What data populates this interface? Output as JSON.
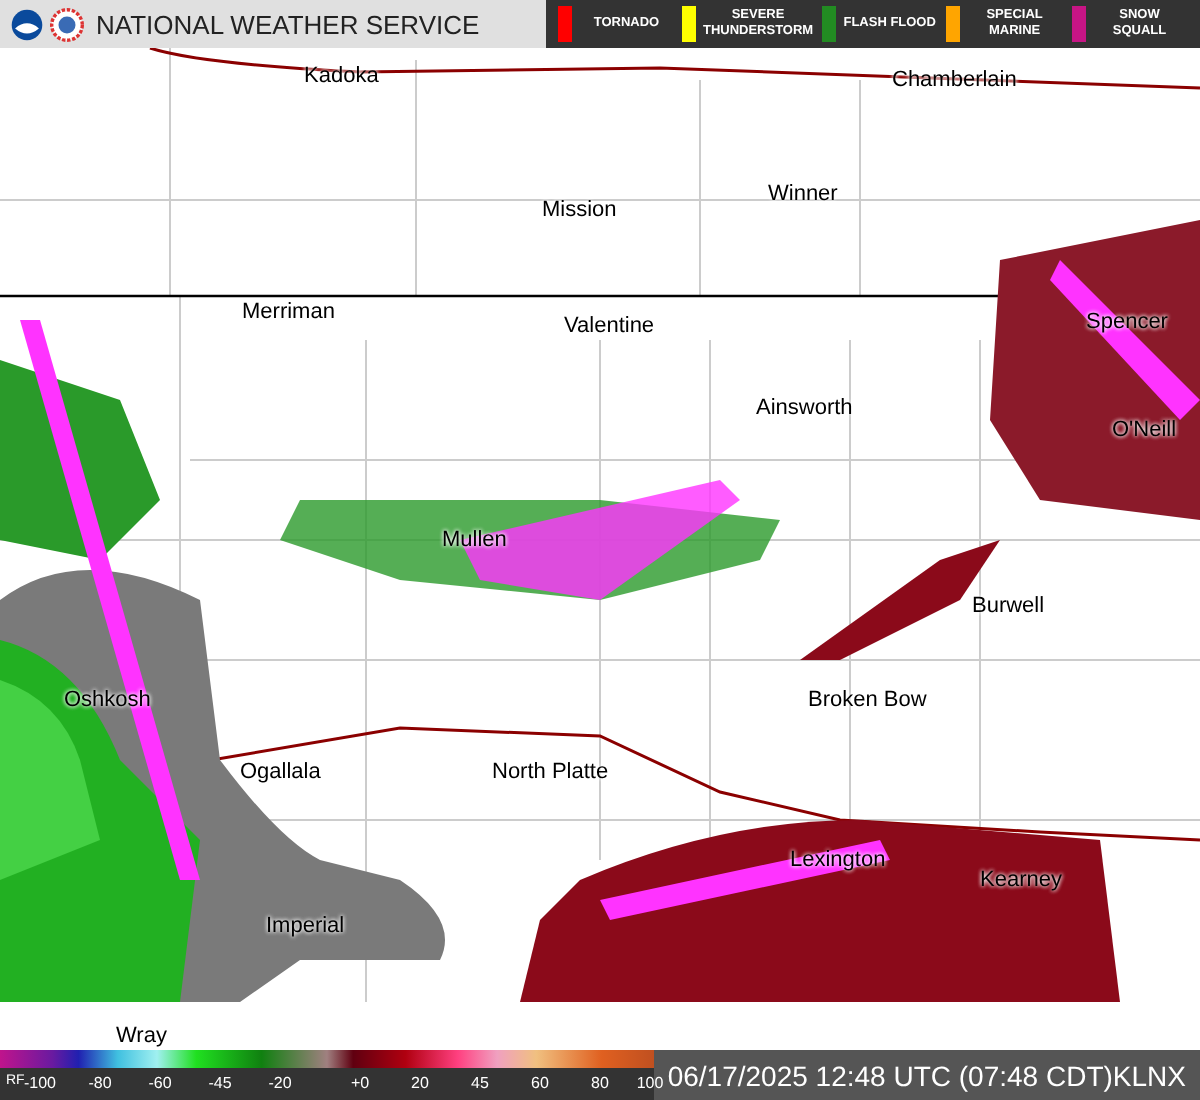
{
  "header": {
    "title": "NATIONAL WEATHER SERVICE"
  },
  "warnings": [
    {
      "label": "TORNADO",
      "color": "#ff0000"
    },
    {
      "label": "SEVERE THUNDERSTORM",
      "color": "#ffff00"
    },
    {
      "label": "FLASH FLOOD",
      "color": "#228b22"
    },
    {
      "label": "SPECIAL MARINE",
      "color": "#ffa500"
    },
    {
      "label": "SNOW SQUALL",
      "color": "#c71585"
    }
  ],
  "map": {
    "cities": [
      {
        "name": "Kadoka"
      },
      {
        "name": "Chamberlain"
      },
      {
        "name": "Mission"
      },
      {
        "name": "Winner"
      },
      {
        "name": "Merriman"
      },
      {
        "name": "Valentine"
      },
      {
        "name": "Ainsworth"
      },
      {
        "name": "Spencer"
      },
      {
        "name": "O'Neill"
      },
      {
        "name": "Mullen"
      },
      {
        "name": "Burwell"
      },
      {
        "name": "Oshkosh"
      },
      {
        "name": "Broken Bow"
      },
      {
        "name": "Ogallala"
      },
      {
        "name": "North Platte"
      },
      {
        "name": "Lexington"
      },
      {
        "name": "Kearney"
      },
      {
        "name": "Imperial"
      },
      {
        "name": "Wray"
      }
    ]
  },
  "scale": {
    "label": "RF",
    "ticks": [
      "-100",
      "-80",
      "-60",
      "-45",
      "-20",
      "+0",
      "20",
      "45",
      "60",
      "80",
      "100"
    ]
  },
  "status": {
    "timestamp": "06/17/2025 12:48 UTC (07:48 CDT)",
    "station": "KLNX"
  }
}
